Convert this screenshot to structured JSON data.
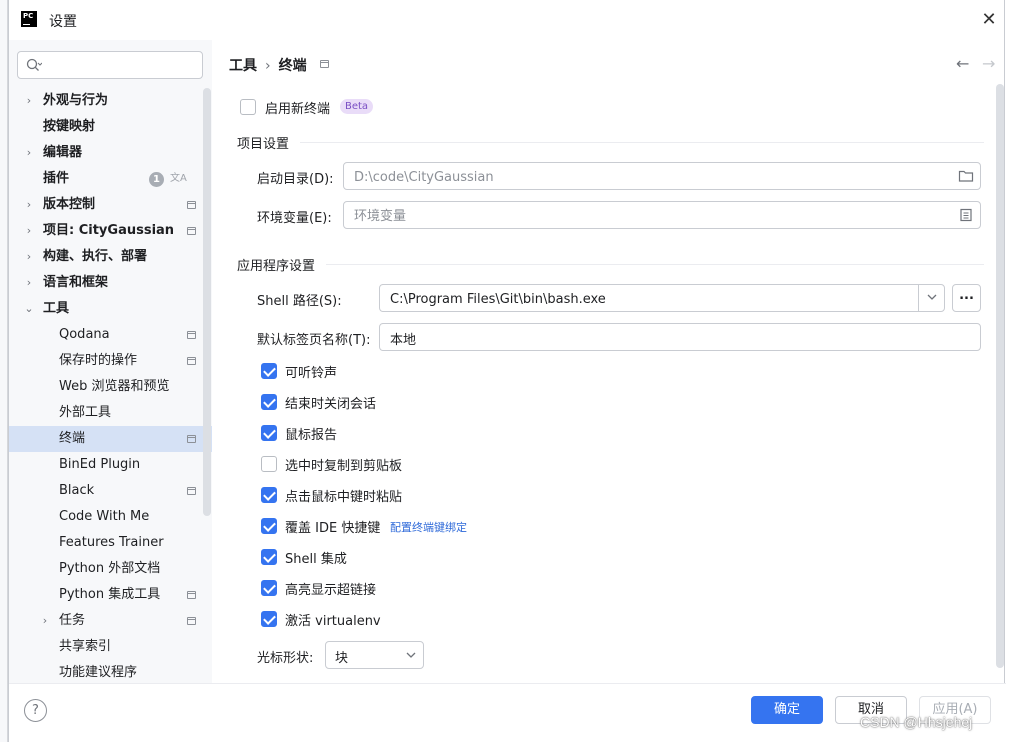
{
  "window": {
    "title": "设置",
    "close_glyph": "✕",
    "logo_text": "PC"
  },
  "search": {
    "placeholder": ""
  },
  "sidebar": {
    "items": [
      {
        "label": "外观与行为",
        "chevron": "›",
        "bold": true
      },
      {
        "label": "按键映射",
        "chevron": "",
        "bold": true
      },
      {
        "label": "编辑器",
        "chevron": "›",
        "bold": true
      },
      {
        "label": "插件",
        "chevron": "",
        "bold": true,
        "badge": "1"
      },
      {
        "label": "版本控制",
        "chevron": "›",
        "bold": true,
        "project_icon": true
      },
      {
        "label": "项目: CityGaussian",
        "chevron": "›",
        "bold": true,
        "project_icon": true
      },
      {
        "label": "构建、执行、部署",
        "chevron": "›",
        "bold": true
      },
      {
        "label": "语言和框架",
        "chevron": "›",
        "bold": true
      },
      {
        "label": "工具",
        "chevron": "⌄",
        "bold": true
      },
      {
        "label": "Qodana",
        "child": true,
        "project_icon": true
      },
      {
        "label": "保存时的操作",
        "child": true,
        "project_icon": true
      },
      {
        "label": "Web 浏览器和预览",
        "child": true
      },
      {
        "label": "外部工具",
        "child": true
      },
      {
        "label": "终端",
        "child": true,
        "selected": true,
        "project_icon": true
      },
      {
        "label": "BinEd Plugin",
        "child": true
      },
      {
        "label": "Black",
        "child": true,
        "project_icon": true
      },
      {
        "label": "Code With Me",
        "child": true
      },
      {
        "label": "Features Trainer",
        "child": true
      },
      {
        "label": "Python 外部文档",
        "child": true
      },
      {
        "label": "Python 集成工具",
        "child": true,
        "project_icon": true
      },
      {
        "label": "任务",
        "child": true,
        "chevron": "›",
        "project_icon": true
      },
      {
        "label": "共享索引",
        "child": true
      },
      {
        "label": "功能建议程序",
        "child": true
      }
    ]
  },
  "breadcrumb": {
    "parent": "工具",
    "separator": "›",
    "current": "终端"
  },
  "new_terminal": {
    "label": "启用新终端",
    "badge": "Beta",
    "checked": false
  },
  "project_settings": {
    "title": "项目设置",
    "start_dir_label": "启动目录(D):",
    "start_dir_value": "D:\\code\\CityGaussian",
    "env_label": "环境变量(E):",
    "env_placeholder": "环境变量"
  },
  "app_settings": {
    "title": "应用程序设置",
    "shell_path_label": "Shell 路径(S):",
    "shell_path_value": "C:\\Program Files\\Git\\bin\\bash.exe",
    "ellipsis": "...",
    "tab_name_label": "默认标签页名称(T):",
    "tab_name_value": "本地",
    "checkboxes": [
      {
        "label": "可听铃声",
        "checked": true
      },
      {
        "label": "结束时关闭会话",
        "checked": true
      },
      {
        "label": "鼠标报告",
        "checked": true
      },
      {
        "label": "选中时复制到剪贴板",
        "checked": false
      },
      {
        "label": "点击鼠标中键时粘贴",
        "checked": true
      },
      {
        "label": "覆盖 IDE 快捷键",
        "checked": true,
        "link": "配置终端键绑定"
      },
      {
        "label": "Shell 集成",
        "checked": true
      },
      {
        "label": "高亮显示超链接",
        "checked": true
      },
      {
        "label": "激活 virtualenv",
        "checked": true
      }
    ],
    "cursor_shape_label": "光标形状:",
    "cursor_shape_value": "块"
  },
  "footer": {
    "help": "?",
    "ok": "确定",
    "cancel": "取消",
    "apply": "应用(A)"
  },
  "watermark": "CSDN @Hhsjehej",
  "colors": {
    "accent": "#3574f0",
    "selected_bg": "#d5e1f5",
    "sidebar_bg": "#f7f8fa",
    "beta_bg": "#e9dcf8"
  }
}
